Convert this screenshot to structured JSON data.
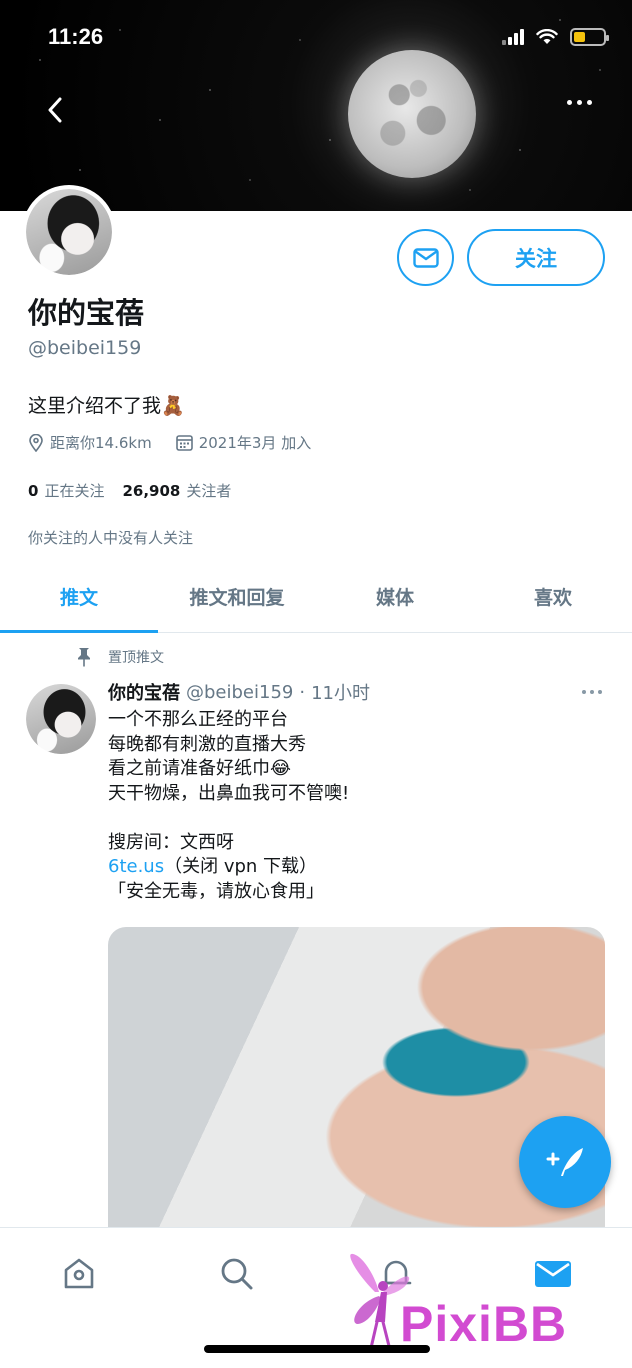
{
  "status_bar": {
    "time": "11:26"
  },
  "profile": {
    "name": "你的宝蓓",
    "handle": "@beibei159",
    "bio": "这里介绍不了我🧸",
    "location": "距离你14.6km",
    "joined": "2021年3月 加入",
    "following_count": "0",
    "following_label": "正在关注",
    "followers_count": "26,908",
    "followers_label": "关注者",
    "mutual_note": "你关注的人中没有人关注",
    "follow_label": "关注"
  },
  "tabs": [
    {
      "label": "推文",
      "active": true
    },
    {
      "label": "推文和回复"
    },
    {
      "label": "媒体"
    },
    {
      "label": "喜欢"
    }
  ],
  "tweet": {
    "pinned_label": "置顶推文",
    "name": "你的宝蓓",
    "handle": "@beibei159",
    "separator": "·",
    "time": "11小时",
    "lines_before_link": "一个不那么正经的平台\n每晚都有刺激的直播大秀\n看之前请准备好纸巾😂\n天干物燥，出鼻血我可不管噢!\n\n搜房间：文西呀\n",
    "link": "6te.us",
    "after_link": "（关闭 vpn 下载）",
    "last_line": "「安全无毒，请放心食用」"
  },
  "watermark": "PixiBB",
  "icons": [
    "back-icon",
    "more-icon",
    "mail-icon",
    "location-icon",
    "calendar-icon",
    "pin-icon",
    "home-icon",
    "search-icon",
    "bell-icon",
    "compose-icon"
  ],
  "colors": {
    "accent": "#1da1f2",
    "secondary_text": "#657786",
    "watermark": "#d24bd1"
  }
}
